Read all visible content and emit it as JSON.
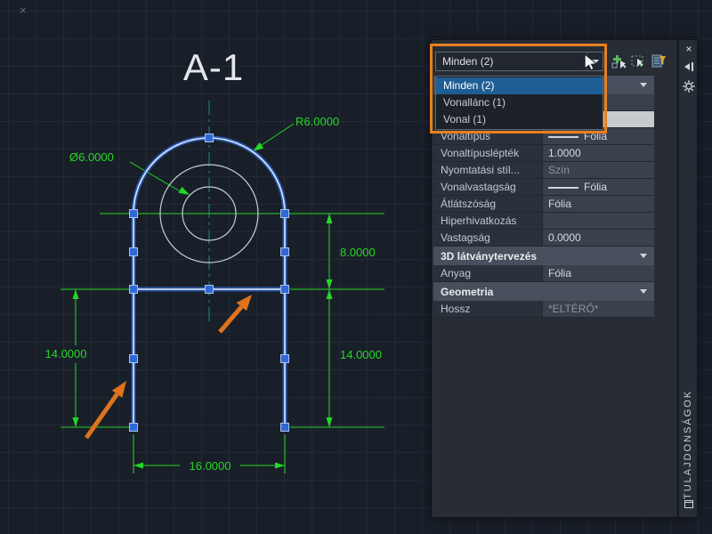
{
  "drawing": {
    "title": "A-1",
    "dimensions": {
      "radius": "R6.0000",
      "diameter": "Ø6.0000",
      "side_upper_right": "8.0000",
      "side_left": "14.0000",
      "side_right": "14.0000",
      "bottom": "16.0000"
    }
  },
  "palette": {
    "selector": {
      "value": "Minden (2)"
    },
    "dropdown_items": [
      {
        "label": "Minden (2)",
        "selected": true
      },
      {
        "label": "Vonallánc (1)",
        "selected": false
      },
      {
        "label": "Vonal (1)",
        "selected": false
      }
    ],
    "rows": [
      {
        "type": "section",
        "label": ""
      },
      {
        "type": "row",
        "label": "",
        "value": ""
      },
      {
        "type": "row",
        "label": "",
        "value": "",
        "light": true
      },
      {
        "type": "row",
        "label": "Vonaltípus",
        "value": "Fólia",
        "line_sample": true
      },
      {
        "type": "row",
        "label": "Vonaltípuslépték",
        "value": "1.0000"
      },
      {
        "type": "row",
        "label": "Nyomtatási stíl...",
        "value": "Szín",
        "muted": true
      },
      {
        "type": "row",
        "label": "Vonalvastagság",
        "value": "Fólia",
        "line_sample": true
      },
      {
        "type": "row",
        "label": "Átlátszóság",
        "value": "Fólia"
      },
      {
        "type": "row",
        "label": "Hiperhivatkozás",
        "value": ""
      },
      {
        "type": "row",
        "label": "Vastagság",
        "value": "0.0000"
      },
      {
        "type": "section",
        "label": "3D látványtervezés"
      },
      {
        "type": "row",
        "label": "Anyag",
        "value": "Fólia"
      },
      {
        "type": "section",
        "label": "Geometria"
      },
      {
        "type": "row",
        "label": "Hossz",
        "value": "*ELTÉRŐ*",
        "muted": true
      }
    ],
    "side_title": "TULAJDONSÁGOK"
  },
  "colors": {
    "accent_orange": "#e8801f",
    "dimension_green": "#25d825",
    "selection_blue": "#2a5fc0",
    "grip_blue": "#3268d6",
    "centerline_teal": "#178c90",
    "panel_bg": "#272c35"
  }
}
